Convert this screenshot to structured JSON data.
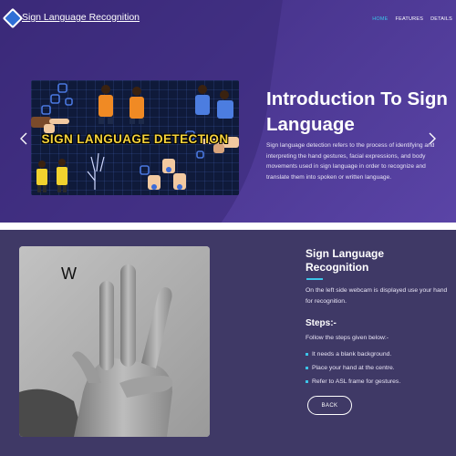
{
  "navbar": {
    "brand": "Sign Language Recognition",
    "links": [
      "HOME",
      "FEATURES",
      "DETAILS"
    ],
    "active_link": "HOME"
  },
  "hero": {
    "banner_title": "SIGN LANGUAGE DETECTION",
    "heading": "Introduction To Sign Language",
    "paragraph": "Sign language detection refers to the process of identifying and interpreting the hand gestures, facial expressions, and body movements used in sign language in order to recognize and translate them into spoken or written language.",
    "prev_icon": "chevron-left-icon",
    "next_icon": "chevron-right-icon"
  },
  "recognition": {
    "webcam_letter": "W",
    "title": "Sign Language Recognition",
    "description": "On the left side webcam is displayed use your hand for recognition.",
    "steps_heading": "Steps:-",
    "steps_intro": "Follow the steps given below:-",
    "steps": [
      "It needs a blank background.",
      "Place your hand at the centre.",
      "Refer to ASL frame for gestures."
    ],
    "back_label": "BACK"
  },
  "colors": {
    "accent": "#3cc4e8",
    "hero_bg": "#4a3690",
    "section_bg": "#3f3966",
    "banner_title": "#f5d23a"
  }
}
